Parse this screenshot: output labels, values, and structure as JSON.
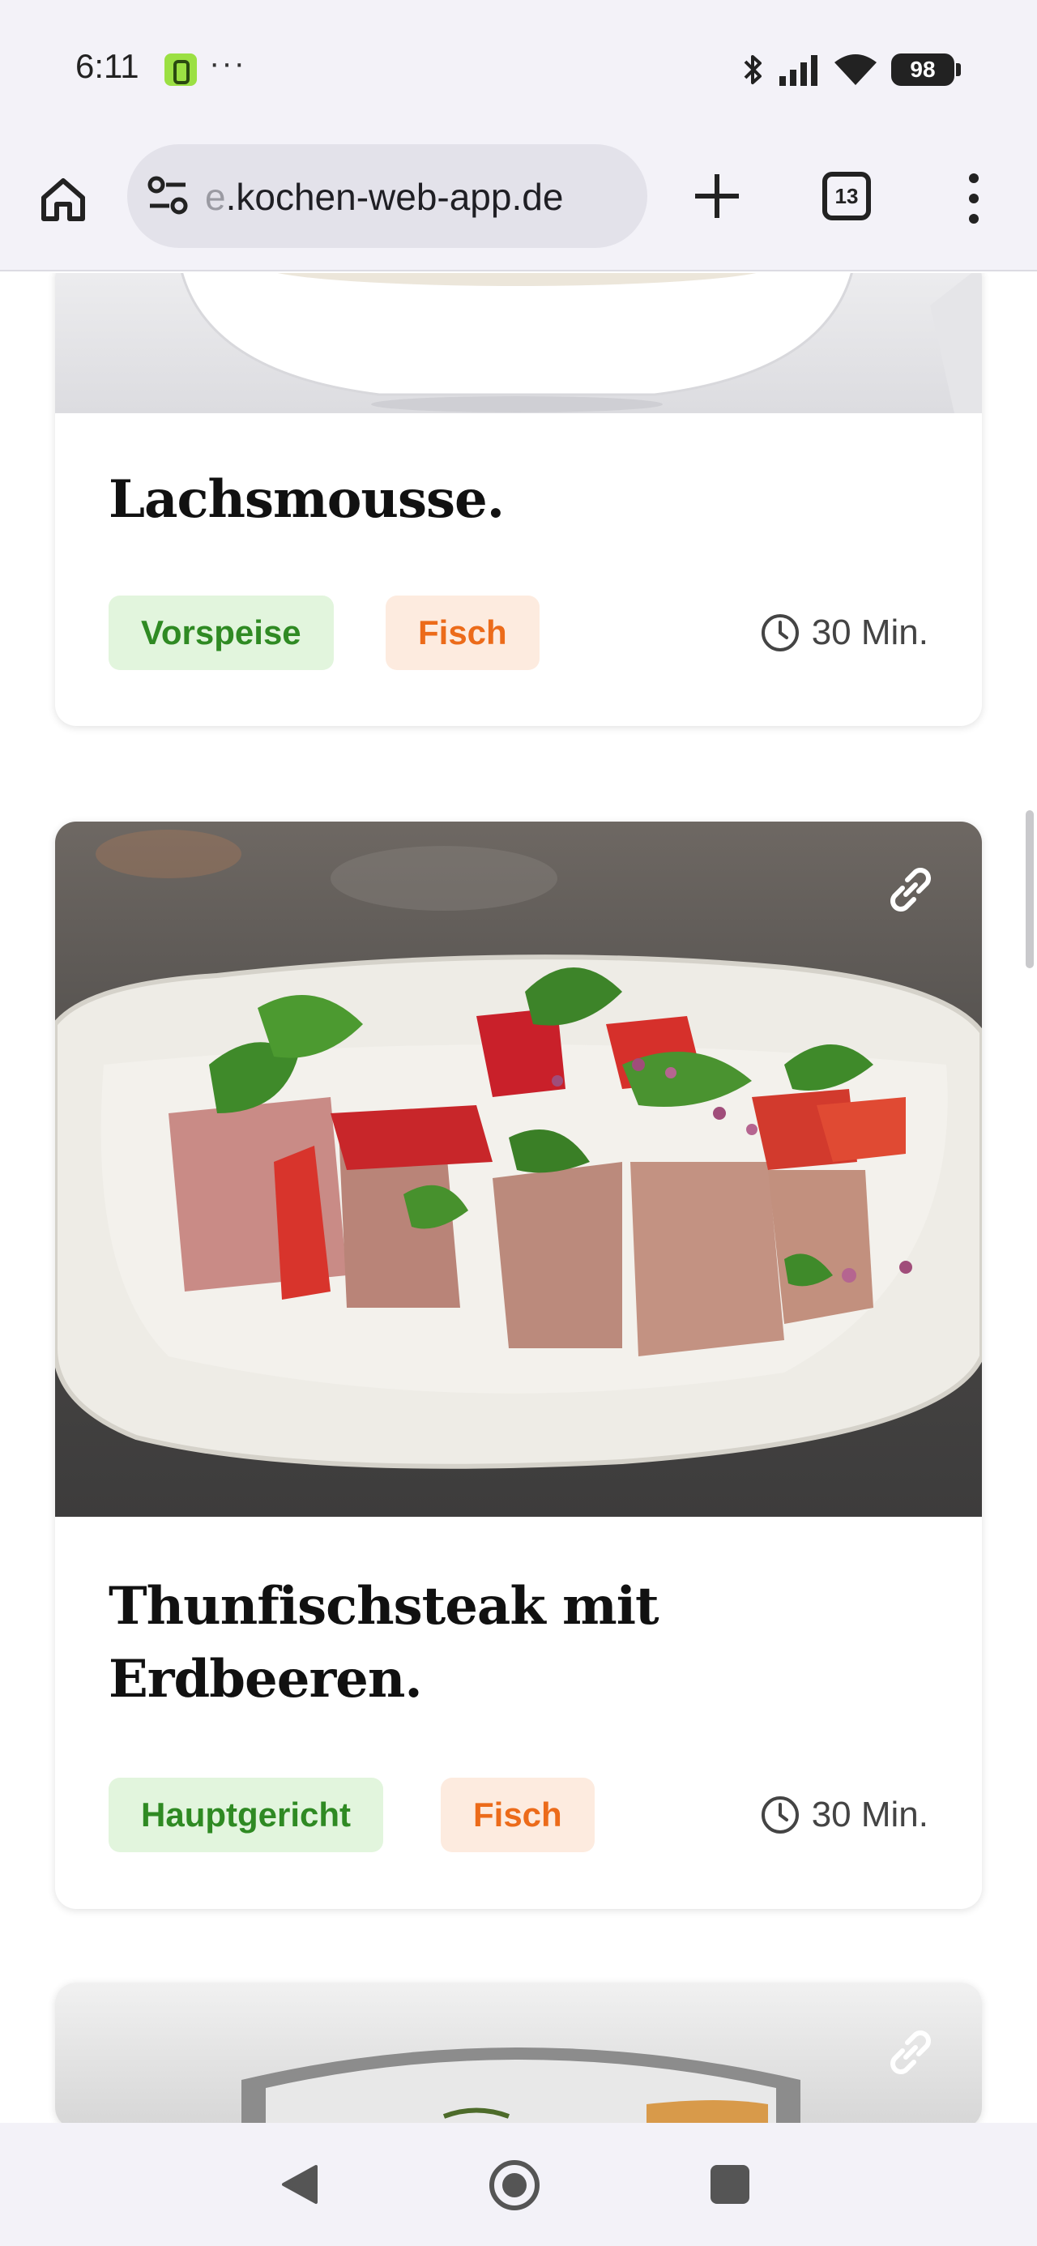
{
  "status_bar": {
    "time": "6:11",
    "dots": "···",
    "battery": "98",
    "icons": [
      "bluetooth-icon",
      "signal-icon",
      "wifi-icon",
      "battery-icon"
    ]
  },
  "browser": {
    "url_fade": "e",
    "url_main": ".kochen-web-app.de",
    "tab_count": "13",
    "icons": [
      "home-icon",
      "site-settings-icon",
      "plus-icon",
      "tabs-icon",
      "more-vert-icon"
    ]
  },
  "recipes": [
    {
      "title": "Lachsmousse.",
      "tags": [
        {
          "label": "Vorspeise",
          "color": "#2f8a23"
        },
        {
          "label": "Fisch",
          "color": "#ec6b1a"
        }
      ],
      "duration": "30 Min."
    },
    {
      "title_line1": "Thunfischsteak mit",
      "title_line2": "Erdbeeren.",
      "tags": [
        {
          "label": "Hauptgericht",
          "color": "#2f8a23"
        },
        {
          "label": "Fisch",
          "color": "#ec6b1a"
        }
      ],
      "duration": "30 Min."
    }
  ],
  "colors": {
    "chrome_bg": "#f3f2f8",
    "tag_green_bg": "#e2f5dd",
    "tag_green_text": "#2f8a23",
    "tag_orange_bg": "#fdebdf",
    "tag_orange_text": "#ec6b1a"
  },
  "navigation": {
    "icons": [
      "back-icon",
      "home-circle-icon",
      "recents-icon"
    ]
  }
}
